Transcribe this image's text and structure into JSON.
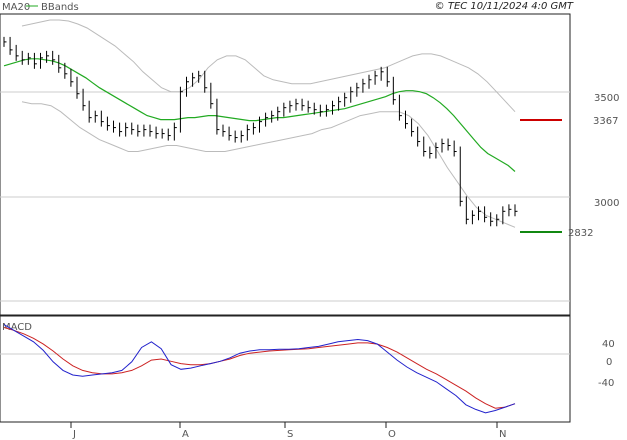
{
  "copyright": "© TEC 10/11/2024 4:0 GMT",
  "legend": {
    "ma_label": "MA20",
    "bb_label": "BBands"
  },
  "colors": {
    "price": "#000000",
    "ma": "#22aa22",
    "bands": "#bbbbbb",
    "resistance": "#cc0000",
    "support": "#118811",
    "macd": "#2222cc",
    "signal": "#cc2222",
    "frame": "#222222",
    "grid": "#cccccc"
  },
  "price_panel": {
    "y_axis_labels": [
      "3500",
      "3000"
    ],
    "levels": [
      {
        "name": "resistance",
        "value": 3367,
        "label": "3367"
      },
      {
        "name": "support",
        "value": 2832,
        "label": "2832"
      }
    ]
  },
  "macd_panel": {
    "title": "MACD",
    "y_axis_labels": [
      "40",
      "0",
      "-40"
    ]
  },
  "x_axis_labels": [
    "J",
    "A",
    "S",
    "O",
    "N"
  ],
  "chart_data": {
    "type": "line",
    "title": "",
    "x_ticks": [
      "J",
      "A",
      "S",
      "O",
      "N"
    ],
    "ylim": [
      2550,
      3990
    ],
    "price_close": [
      3850,
      3810,
      3780,
      3760,
      3770,
      3740,
      3770,
      3780,
      3760,
      3720,
      3690,
      3650,
      3590,
      3530,
      3470,
      3480,
      3450,
      3430,
      3420,
      3400,
      3420,
      3410,
      3400,
      3410,
      3400,
      3390,
      3390,
      3380,
      3420,
      3600,
      3650,
      3670,
      3680,
      3620,
      3540,
      3410,
      3400,
      3380,
      3370,
      3380,
      3410,
      3420,
      3450,
      3470,
      3480,
      3500,
      3520,
      3530,
      3540,
      3530,
      3520,
      3510,
      3500,
      3510,
      3530,
      3550,
      3570,
      3600,
      3620,
      3640,
      3660,
      3680,
      3700,
      3650,
      3560,
      3480,
      3440,
      3400,
      3350,
      3300,
      3290,
      3320,
      3340,
      3330,
      3300,
      3050,
      2960,
      2980,
      3000,
      2970,
      2950,
      2960,
      3000,
      3010,
      3000
    ],
    "ma20": [
      3730,
      3740,
      3750,
      3760,
      3765,
      3765,
      3760,
      3755,
      3745,
      3730,
      3710,
      3690,
      3670,
      3645,
      3620,
      3600,
      3580,
      3560,
      3540,
      3520,
      3500,
      3480,
      3470,
      3460,
      3460,
      3460,
      3465,
      3470,
      3470,
      3475,
      3480,
      3480,
      3475,
      3470,
      3465,
      3460,
      3455,
      3455,
      3460,
      3465,
      3470,
      3470,
      3475,
      3480,
      3485,
      3490,
      3495,
      3500,
      3505,
      3510,
      3515,
      3525,
      3535,
      3545,
      3555,
      3565,
      3575,
      3590,
      3600,
      3605,
      3605,
      3600,
      3590,
      3570,
      3545,
      3515,
      3480,
      3440,
      3400,
      3360,
      3320,
      3290,
      3270,
      3250,
      3230,
      3200
    ],
    "bb_upper": [
      3930,
      3940,
      3950,
      3960,
      3960,
      3955,
      3940,
      3920,
      3890,
      3860,
      3830,
      3790,
      3750,
      3700,
      3660,
      3620,
      3600,
      3600,
      3620,
      3660,
      3720,
      3760,
      3780,
      3780,
      3760,
      3720,
      3680,
      3660,
      3650,
      3640,
      3640,
      3640,
      3650,
      3660,
      3670,
      3680,
      3690,
      3700,
      3710,
      3720,
      3740,
      3760,
      3780,
      3790,
      3790,
      3780,
      3760,
      3740,
      3720,
      3690,
      3650,
      3600,
      3550,
      3500
    ],
    "bb_lower": [
      3550,
      3540,
      3540,
      3530,
      3500,
      3460,
      3420,
      3390,
      3360,
      3340,
      3320,
      3300,
      3300,
      3310,
      3320,
      3330,
      3330,
      3320,
      3310,
      3300,
      3300,
      3300,
      3310,
      3320,
      3330,
      3340,
      3350,
      3360,
      3370,
      3380,
      3390,
      3410,
      3420,
      3440,
      3460,
      3480,
      3490,
      3500,
      3500,
      3500,
      3480,
      3440,
      3380,
      3300,
      3220,
      3150,
      3080,
      3020,
      2980,
      2960,
      2940,
      2920
    ],
    "macd": [
      50,
      40,
      30,
      20,
      5,
      -15,
      -30,
      -38,
      -40,
      -38,
      -36,
      -34,
      -30,
      -15,
      10,
      20,
      8,
      -20,
      -28,
      -26,
      -22,
      -18,
      -14,
      -8,
      0,
      4,
      6,
      6,
      7,
      7,
      8,
      10,
      12,
      16,
      20,
      22,
      24,
      22,
      16,
      2,
      -12,
      -24,
      -34,
      -42,
      -50,
      -62,
      -74,
      -90,
      -98,
      -104,
      -100,
      -94,
      -88
    ],
    "signal": [
      45,
      40,
      34,
      26,
      16,
      4,
      -10,
      -22,
      -30,
      -34,
      -36,
      -36,
      -34,
      -30,
      -22,
      -12,
      -10,
      -14,
      -18,
      -20,
      -20,
      -18,
      -14,
      -10,
      -4,
      0,
      2,
      4,
      5,
      6,
      7,
      8,
      10,
      12,
      14,
      16,
      18,
      18,
      16,
      10,
      2,
      -8,
      -18,
      -28,
      -36,
      -46,
      -56,
      -66,
      -78,
      -88,
      -96,
      -94,
      -88
    ]
  }
}
